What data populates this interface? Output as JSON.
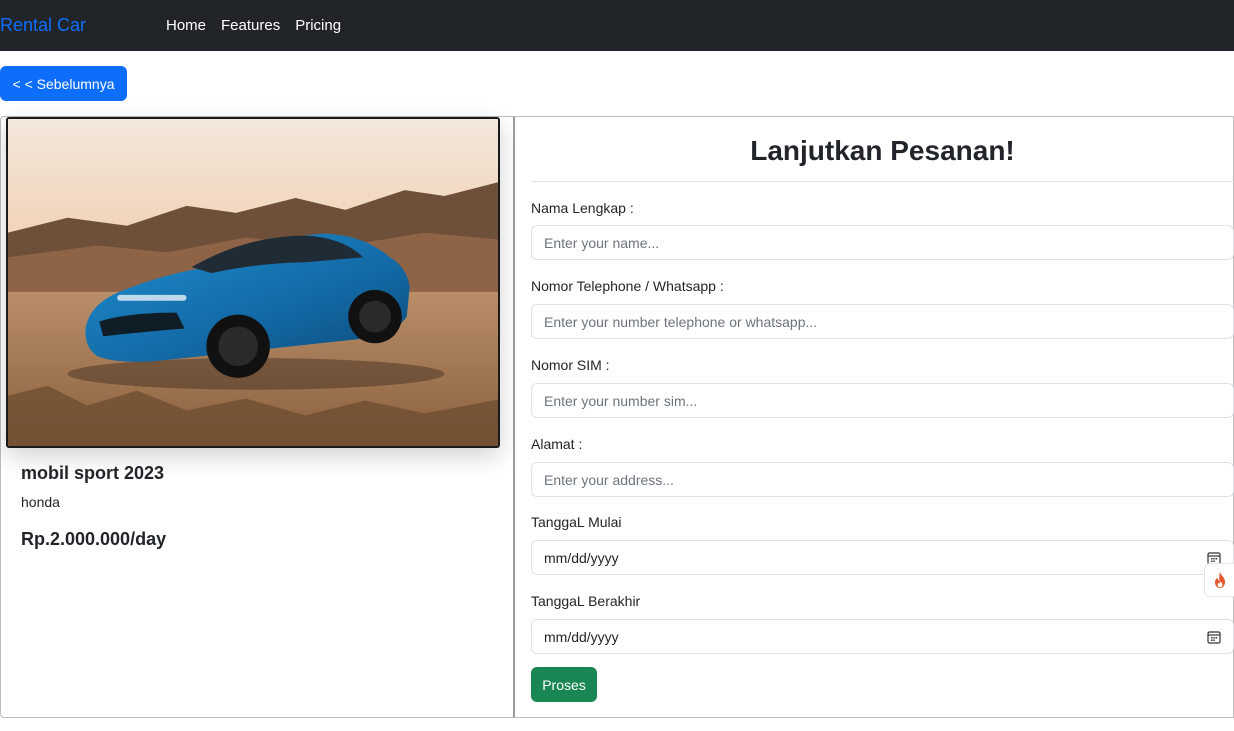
{
  "navbar": {
    "brand": "Rental Car",
    "links": [
      "Home",
      "Features",
      "Pricing"
    ]
  },
  "back_button": "< < Sebelumnya",
  "car": {
    "title": "mobil sport 2023",
    "brand": "honda",
    "price": "Rp.2.000.000/day"
  },
  "form": {
    "title": "Lanjutkan Pesanan!",
    "name_label": "Nama Lengkap :",
    "name_placeholder": "Enter your name...",
    "phone_label": "Nomor Telephone / Whatsapp :",
    "phone_placeholder": "Enter your number telephone or whatsapp...",
    "sim_label": "Nomor SIM :",
    "sim_placeholder": "Enter your number sim...",
    "address_label": "Alamat :",
    "address_placeholder": "Enter your address...",
    "start_label": "TanggaL Mulai",
    "start_value": "mm/dd/yyyy",
    "end_label": "TanggaL Berakhir",
    "end_value": "mm/dd/yyyy",
    "submit": "Proses"
  },
  "colors": {
    "navbar_bg": "#212529",
    "brand": "#0d6efd",
    "primary_button": "#0d6efd",
    "success_button": "#198754"
  },
  "icons": [
    "calendar-icon",
    "fire-icon"
  ]
}
